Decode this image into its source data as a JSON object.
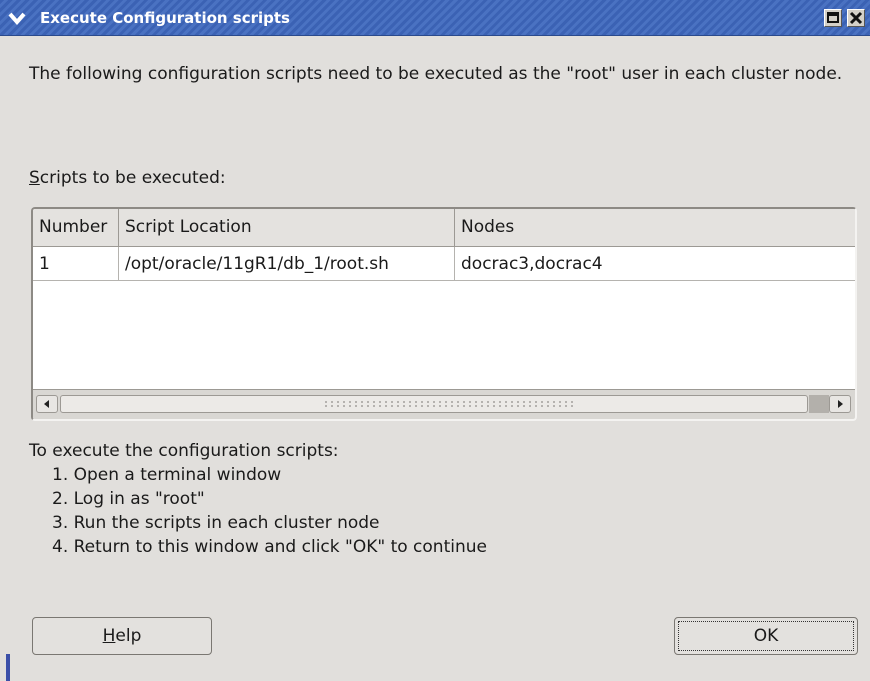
{
  "window": {
    "title": "Execute Configuration scripts"
  },
  "intro_text": "The following configuration scripts need to be executed as the \"root\" user in each cluster node.",
  "scripts_label_first": "S",
  "scripts_label_rest": "cripts to be executed:",
  "table": {
    "headers": [
      "Number",
      "Script Location",
      "Nodes"
    ],
    "rows": [
      [
        "1",
        "/opt/oracle/11gR1/db_1/root.sh",
        "docrac3,docrac4"
      ]
    ]
  },
  "instructions": {
    "heading": "To execute the configuration scripts:",
    "steps": [
      "1. Open a terminal window",
      "2. Log in as \"root\"",
      "3. Run the scripts in each cluster node",
      "4. Return to this window and click \"OK\" to continue"
    ]
  },
  "buttons": {
    "help_mnemonic": "H",
    "help_rest": "elp",
    "ok": "OK"
  },
  "icons": {
    "menu": "chevron-down-icon",
    "maximize": "maximize-icon",
    "close": "close-icon",
    "scroll_left": "arrow-left-icon",
    "scroll_right": "arrow-right-icon"
  },
  "colors": {
    "titlebar": "#3b62b4",
    "window_bg": "#e1dfdc",
    "table_bg": "#ffffff"
  }
}
